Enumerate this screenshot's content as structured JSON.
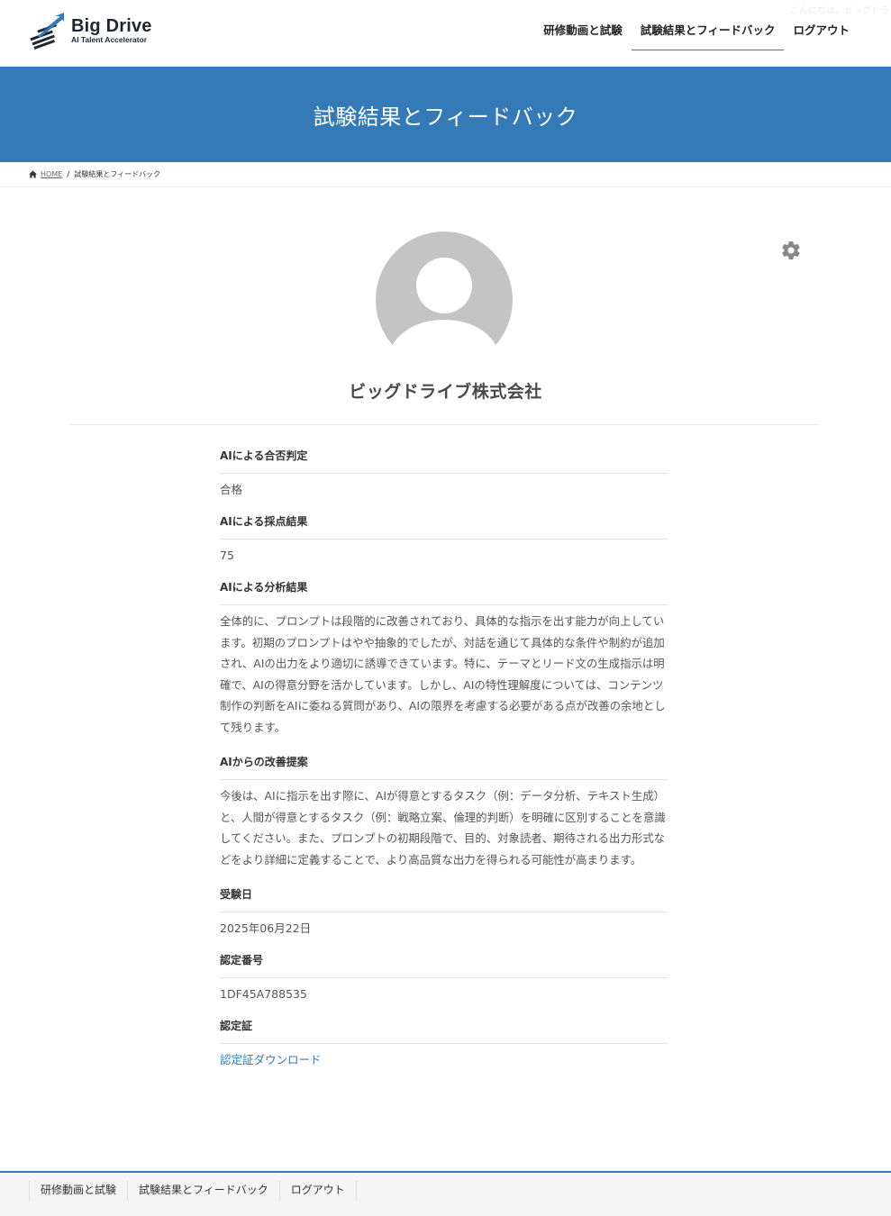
{
  "header": {
    "greeting": "こんにちは、ビッグドラ",
    "logo": {
      "name": "Big Drive",
      "tagline": "AI Talent Accelerator"
    },
    "nav": [
      {
        "label": "研修動画と試験",
        "active": false
      },
      {
        "label": "試験結果とフィードバック",
        "active": true
      },
      {
        "label": "ログアウト",
        "active": false
      }
    ]
  },
  "banner": {
    "title": "試験結果とフィードバック"
  },
  "breadcrumb": {
    "home": "HOME",
    "current": "試験結果とフィードバック"
  },
  "profile": {
    "company_name": "ビッグドライブ株式会社"
  },
  "fields": {
    "judgement": {
      "label": "AIによる合否判定",
      "value": "合格"
    },
    "score": {
      "label": "AIによる採点結果",
      "value": "75"
    },
    "analysis": {
      "label": "AIによる分析結果",
      "value": "全体的に、プロンプトは段階的に改善されており、具体的な指示を出す能力が向上しています。初期のプロンプトはやや抽象的でしたが、対話を通じて具体的な条件や制約が追加され、AIの出力をより適切に誘導できています。特に、テーマとリード文の生成指示は明確で、AIの得意分野を活かしています。しかし、AIの特性理解度については、コンテンツ制作の判断をAIに委ねる質問があり、AIの限界を考慮する必要がある点が改善の余地として残ります。"
    },
    "suggestion": {
      "label": "AIからの改善提案",
      "value": "今後は、AIに指示を出す際に、AIが得意とするタスク（例：データ分析、テキスト生成）と、人間が得意とするタスク（例：戦略立案、倫理的判断）を明確に区別することを意識してください。また、プロンプトの初期段階で、目的、対象読者、期待される出力形式などをより詳細に定義することで、より高品質な出力を得られる可能性が高まります。"
    },
    "exam_date": {
      "label": "受験日",
      "value": "2025年06月22日"
    },
    "cert_number": {
      "label": "認定番号",
      "value": "1DF45A788535"
    },
    "certificate": {
      "label": "認定証",
      "link": "認定証ダウンロード"
    }
  },
  "footer": {
    "nav": [
      "研修動画と試験",
      "試験結果とフィードバック",
      "ログアウト"
    ]
  },
  "colors": {
    "accent": "#337ab7",
    "avatar": "#c4c4c4",
    "gear": "#888888"
  },
  "icons": [
    "home-icon",
    "gear-icon",
    "avatar-placeholder-icon"
  ]
}
